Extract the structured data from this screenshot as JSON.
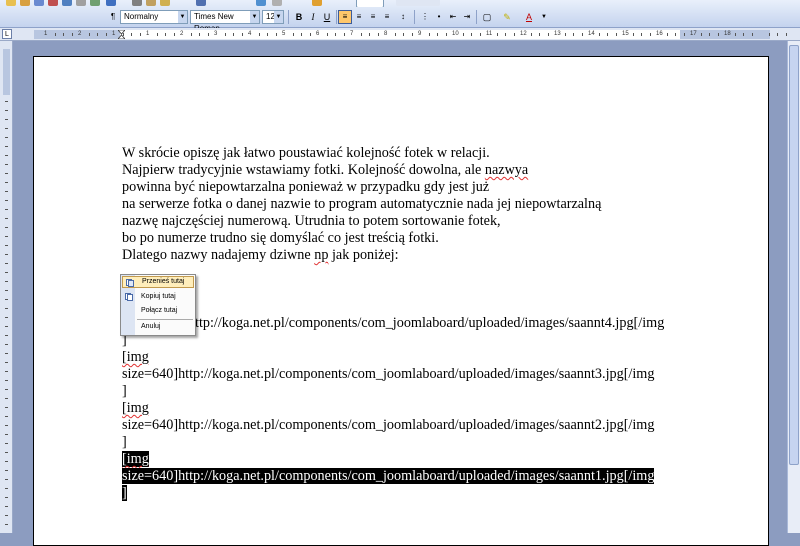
{
  "toolbar": {
    "style": "Normalny",
    "font": "Times New Roman",
    "size": "12",
    "bold": "B",
    "italic": "I",
    "underline": "U",
    "font_color_label": "A"
  },
  "ruler": {
    "corner": "L",
    "numbers": [
      "1",
      "2",
      "1",
      "1",
      "2",
      "3",
      "4",
      "5",
      "6",
      "7",
      "8",
      "9",
      "10",
      "11",
      "12",
      "13",
      "14",
      "15",
      "16",
      "17",
      "18"
    ]
  },
  "document": {
    "lines": [
      "W skrócie opiszę jak łatwo poustawiać kolejność fotek w relacji.",
      "Najpierw tradycyjnie wstawiamy fotki. Kolejność dowolna, ale nazwya",
      "powinna być niepowtarzalna ponieważ w przypadku gdy jest już",
      "na serwerze fotka o danej nazwie to program automatycznie nada jej niepowtarzalną",
      "nazwę najczęściej numerową. Utrudnia to potem sortowanie fotek,",
      "bo po numerze trudno się domyślać co jest treścią fotki.",
      "Dlatego nazwy nadajemy dziwne np jak poniżej:"
    ],
    "img1_tail": "ttp://koga.net.pl/components/com_joomlaboard/uploaded/images/saannt4.jpg[/img",
    "img1_close": "]",
    "img2_open": "[img",
    "img2_line": "size=640]http://koga.net.pl/components/com_joomlaboard/uploaded/images/saannt3.jpg[/img",
    "img2_close": "]",
    "img3_open": "[img",
    "img3_line": "size=640]http://koga.net.pl/components/com_joomlaboard/uploaded/images/saannt2.jpg[/img",
    "img3_close": "]",
    "img4_open": "[img",
    "img4_line": "size=640]http://koga.net.pl/components/com_joomlaboard/uploaded/images/saannt1.jpg[/img",
    "img4_close": "]"
  },
  "context_menu": {
    "items": [
      "Przenieś tutaj",
      "Kopiuj tutaj",
      "Połącz tutaj",
      "Anuluj"
    ]
  },
  "colors": {
    "highlight": "#000000",
    "menu_hover": "#ffeebb",
    "workspace": "#8c9cc0"
  }
}
